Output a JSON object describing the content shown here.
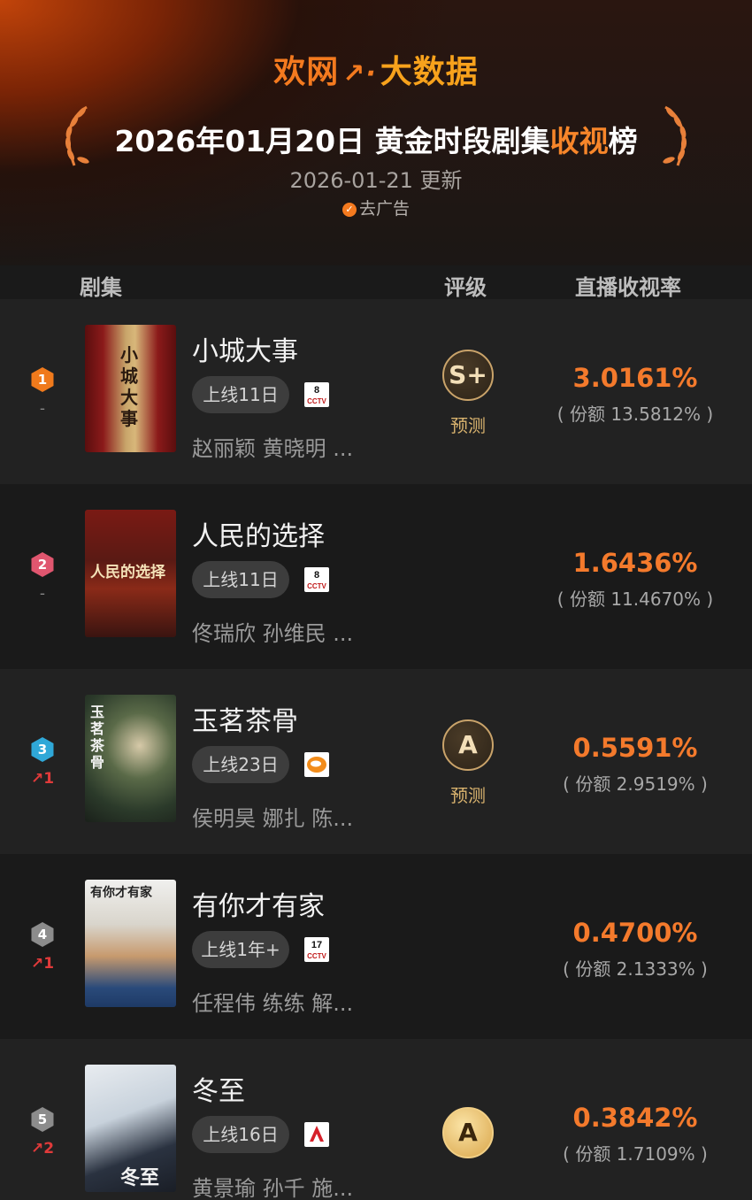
{
  "header": {
    "brand_part1": "欢网",
    "brand_part2": "↗·",
    "brand_part3": "大数据",
    "title_main": "2026年01月20日 黄金时段剧集",
    "title_highlight": "收视",
    "title_end": "榜",
    "updated": "2026-01-21 更新",
    "remove_ads": "去广告"
  },
  "columns": {
    "drama": "剧集",
    "grade": "评级",
    "rating": "直播收视率"
  },
  "colors": {
    "accent": "#f47a2c",
    "up": "#e03a3a",
    "rank1": "#f07a1c",
    "rank2": "#e0566f",
    "rank3": "#2fa8d8",
    "rank4": "#8c8c8c",
    "rank5": "#8c8c8c"
  },
  "rows": [
    {
      "rank": "1",
      "change": "-",
      "title": "小城大事",
      "online": "上线11日",
      "channel": "8",
      "channel_logo": "cctv-icon",
      "cast": "赵丽颖 黄晓明 ...",
      "grade": "S+",
      "grade_note": "预测",
      "rating": "3.0161%",
      "share": "( 份额 13.5812% )",
      "poster_text": "小城大事"
    },
    {
      "rank": "2",
      "change": "-",
      "title": "人民的选择",
      "online": "上线11日",
      "channel": "8",
      "channel_logo": "cctv-icon",
      "cast": "佟瑞欣 孙维民 ...",
      "grade": "",
      "grade_note": "",
      "rating": "1.6436%",
      "share": "( 份额 11.4670% )",
      "poster_text": "人民的选择"
    },
    {
      "rank": "3",
      "change": "↗1",
      "title": "玉茗茶骨",
      "online": "上线23日",
      "channel": "",
      "channel_logo": "hunan-tv-icon",
      "cast": "侯明昊 娜扎 陈...",
      "grade": "A",
      "grade_note": "预测",
      "rating": "0.5591%",
      "share": "( 份额 2.9519% )",
      "poster_text": "玉茗茶骨"
    },
    {
      "rank": "4",
      "change": "↗1",
      "title": "有你才有家",
      "online": "上线1年+",
      "channel": "17",
      "channel_logo": "cctv-icon",
      "cast": "任程伟 练练 解...",
      "grade": "",
      "grade_note": "",
      "rating": "0.4700%",
      "share": "( 份额 2.1333% )",
      "poster_text": "有你才有家"
    },
    {
      "rank": "5",
      "change": "↗2",
      "title": "冬至",
      "online": "上线16日",
      "channel": "",
      "channel_logo": "jiangsu-tv-icon",
      "cast": "黄景瑜 孙千 施...",
      "grade": "A",
      "grade_note": "",
      "rating": "0.3842%",
      "share": "( 份额 1.7109% )",
      "poster_text": "冬至"
    }
  ]
}
